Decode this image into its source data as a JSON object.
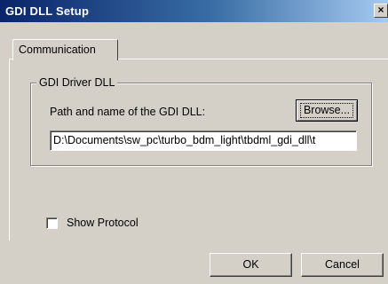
{
  "window": {
    "title": "GDI DLL Setup",
    "close_glyph": "×"
  },
  "tabs": [
    {
      "label": "Communication",
      "selected": true
    }
  ],
  "group": {
    "legend": "GDI Driver DLL",
    "path_label": "Path and name of the GDI DLL:",
    "browse_label": "Browse...",
    "path_value": "D:\\Documents\\sw_pc\\turbo_bdm_light\\tbdml_gdi_dll\\t"
  },
  "options": {
    "show_protocol_label": "Show Protocol",
    "show_protocol_checked": false
  },
  "buttons": {
    "ok": "OK",
    "cancel": "Cancel"
  },
  "colors": {
    "dialog_face": "#d4d0c8",
    "titlebar_start": "#0a246a",
    "titlebar_end": "#a6caf0"
  }
}
